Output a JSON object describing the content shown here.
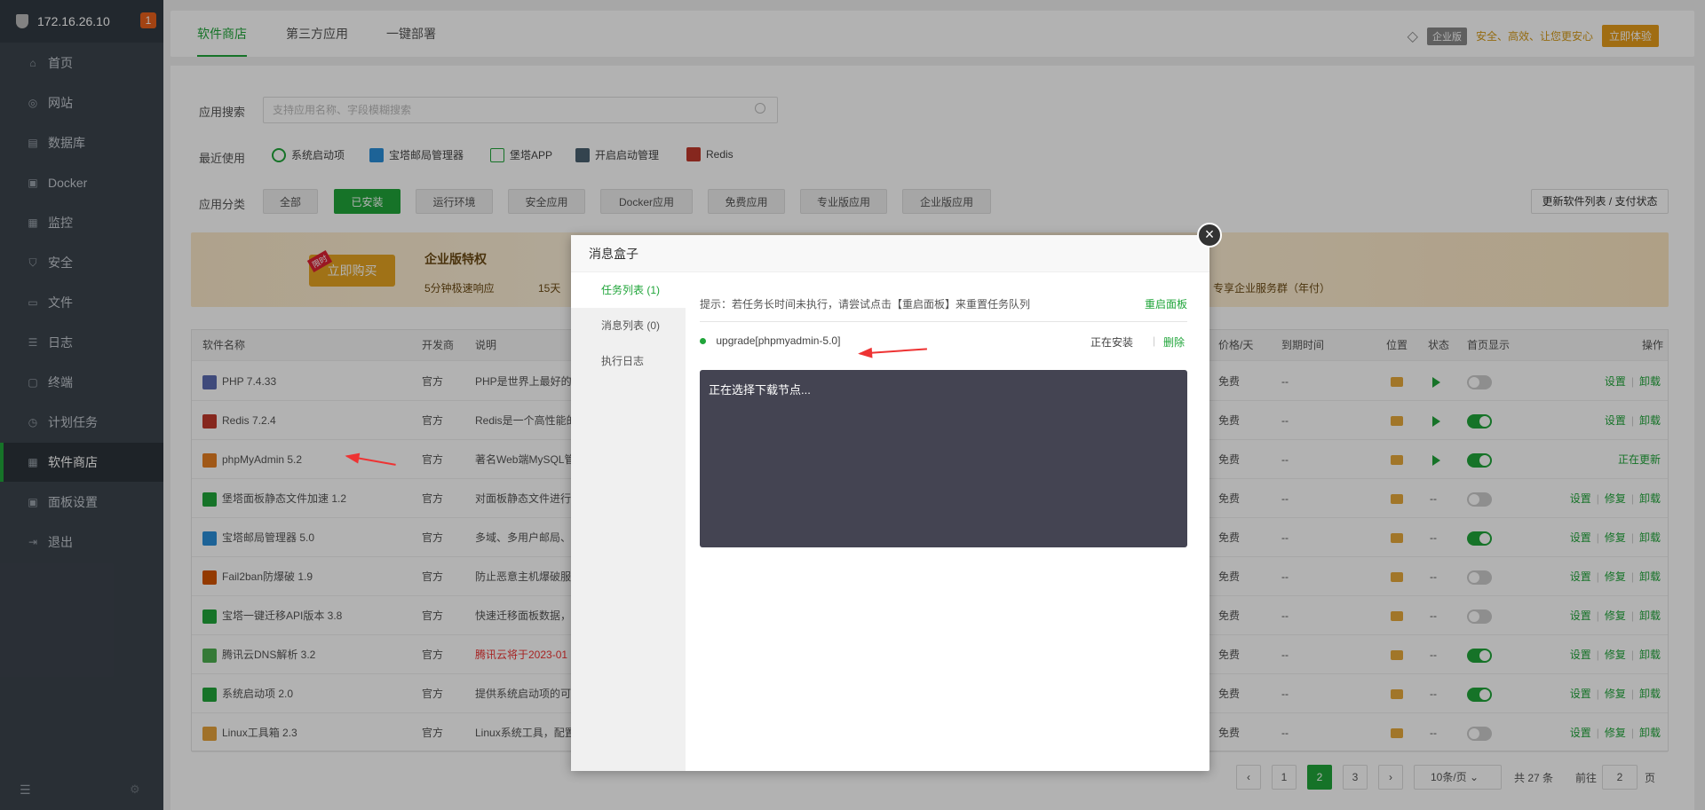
{
  "sidebar": {
    "ip": "172.16.26.10",
    "badge": "1",
    "items": [
      {
        "label": "首页",
        "icon": "home-icon"
      },
      {
        "label": "网站",
        "icon": "globe-icon"
      },
      {
        "label": "数据库",
        "icon": "database-icon"
      },
      {
        "label": "Docker",
        "icon": "docker-icon"
      },
      {
        "label": "监控",
        "icon": "monitor-icon"
      },
      {
        "label": "安全",
        "icon": "shield-icon"
      },
      {
        "label": "文件",
        "icon": "folder-icon"
      },
      {
        "label": "日志",
        "icon": "log-icon"
      },
      {
        "label": "终端",
        "icon": "terminal-icon"
      },
      {
        "label": "计划任务",
        "icon": "clock-icon"
      },
      {
        "label": "软件商店",
        "icon": "grid-icon"
      },
      {
        "label": "面板设置",
        "icon": "settings-icon"
      },
      {
        "label": "退出",
        "icon": "logout-icon"
      }
    ]
  },
  "tabs": [
    "软件商店",
    "第三方应用",
    "一键部署"
  ],
  "promo": {
    "tag": "企业版",
    "text": "安全、高效、让您更安心",
    "button": "立即体验"
  },
  "search": {
    "label": "应用搜索",
    "placeholder": "支持应用名称、字段模糊搜索"
  },
  "recent": {
    "label": "最近使用",
    "items": [
      "系统启动项",
      "宝塔邮局管理器",
      "堡塔APP",
      "开启启动管理",
      "Redis"
    ]
  },
  "categories": {
    "label": "应用分类",
    "items": [
      "全部",
      "已安装",
      "运行环境",
      "安全应用",
      "Docker应用",
      "免费应用",
      "专业版应用",
      "企业版应用"
    ],
    "update_button": "更新软件列表 / 支付状态"
  },
  "banner": {
    "buy_button": "立即购买",
    "buy_tag": "限时",
    "title": "企业版特权",
    "feature1": "5分钟极速响应",
    "feature2": "15天",
    "feature3": "专享企业服务群（年付）"
  },
  "table": {
    "headers": [
      "软件名称",
      "开发商",
      "说明",
      "价格/天",
      "到期时间",
      "位置",
      "状态",
      "首页显示",
      "操作"
    ],
    "rows": [
      {
        "name": "PHP 7.4.33",
        "dev": "官方",
        "desc": "PHP是世界上最好的",
        "price": "免费",
        "expire": "--",
        "status": "play",
        "toggle": false,
        "ops": [
          "设置",
          "卸载"
        ]
      },
      {
        "name": "Redis 7.2.4",
        "dev": "官方",
        "desc": "Redis是一个高性能的",
        "price": "免费",
        "expire": "--",
        "status": "play",
        "toggle": true,
        "ops": [
          "设置",
          "卸载"
        ]
      },
      {
        "name": "phpMyAdmin 5.2",
        "dev": "官方",
        "desc": "著名Web端MySQL管",
        "price": "免费",
        "expire": "--",
        "status": "play",
        "toggle": true,
        "ops": [
          "正在更新"
        ]
      },
      {
        "name": "堡塔面板静态文件加速 1.2",
        "dev": "官方",
        "desc": "对面板静态文件进行",
        "price": "免费",
        "expire": "--",
        "status": "--",
        "toggle": false,
        "ops": [
          "设置",
          "修复",
          "卸载"
        ]
      },
      {
        "name": "宝塔邮局管理器 5.0",
        "dev": "官方",
        "desc": "多域、多用户邮局、",
        "price": "免费",
        "expire": "--",
        "status": "--",
        "toggle": true,
        "ops": [
          "设置",
          "修复",
          "卸载"
        ]
      },
      {
        "name": "Fail2ban防爆破 1.9",
        "dev": "官方",
        "desc": "防止恶意主机爆破服",
        "price": "免费",
        "expire": "--",
        "status": "--",
        "toggle": false,
        "ops": [
          "设置",
          "修复",
          "卸载"
        ]
      },
      {
        "name": "宝塔一键迁移API版本 3.8",
        "dev": "官方",
        "desc": "快速迁移面板数据，",
        "price": "免费",
        "expire": "--",
        "status": "--",
        "toggle": false,
        "ops": [
          "设置",
          "修复",
          "卸载"
        ]
      },
      {
        "name": "腾讯云DNS解析 3.2",
        "dev": "官方",
        "desc": "腾讯云将于2023-01",
        "price": "免费",
        "expire": "--",
        "status": "--",
        "toggle": true,
        "ops": [
          "设置",
          "修复",
          "卸载"
        ]
      },
      {
        "name": "系统启动项 2.0",
        "dev": "官方",
        "desc": "提供系统启动项的可",
        "price": "免费",
        "expire": "--",
        "status": "--",
        "toggle": true,
        "ops": [
          "设置",
          "修复",
          "卸载"
        ]
      },
      {
        "name": "Linux工具箱 2.3",
        "dev": "官方",
        "desc": "Linux系统工具，配置",
        "price": "免费",
        "expire": "--",
        "status": "--",
        "toggle": false,
        "ops": [
          "设置",
          "修复",
          "卸载"
        ]
      }
    ]
  },
  "pagination": {
    "pages": [
      "1",
      "2",
      "3"
    ],
    "current": "2",
    "per_page": "10条/页",
    "total": "共 27 条",
    "goto_label": "前往",
    "goto_value": "2",
    "goto_suffix": "页"
  },
  "modal": {
    "title": "消息盒子",
    "side": [
      "任务列表 (1)",
      "消息列表 (0)",
      "执行日志"
    ],
    "hint": "提示：若任务长时间未执行，请尝试点击【重启面板】来重置任务队列",
    "restart": "重启面板",
    "task_name": "upgrade[phpmyadmin-5.0]",
    "task_status": "正在安装",
    "task_delete": "删除",
    "console": "正在选择下载节点..."
  },
  "colors": {
    "accent": "#20a53a",
    "sidebar": "#3c444d",
    "console": "#444452",
    "arrow": "#e33333"
  }
}
